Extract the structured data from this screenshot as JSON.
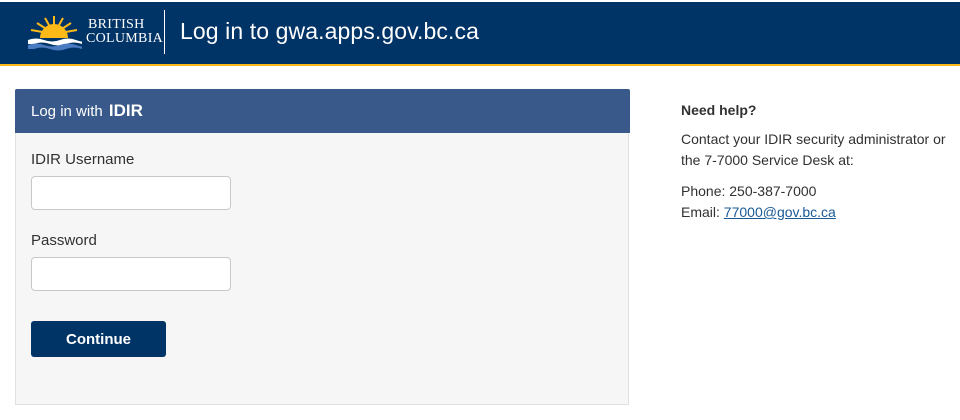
{
  "header": {
    "logo": {
      "line1": "BRITISH",
      "line2": "COLUMBIA",
      "icon": "bc-sun-logo-icon"
    },
    "title": "Log in to gwa.apps.gov.bc.ca"
  },
  "login": {
    "heading_prefix": "Log in with",
    "heading_brand": "IDIR",
    "username_label": "IDIR Username",
    "username_value": "",
    "password_label": "Password",
    "password_value": "",
    "continue_label": "Continue"
  },
  "help": {
    "title": "Need help?",
    "description": "Contact your IDIR security administrator or the 7-7000 Service Desk at:",
    "phone_label": "Phone:",
    "phone_value": "250-387-7000",
    "email_label": "Email:",
    "email_value": "77000@gov.bc.ca"
  },
  "colors": {
    "header_bg": "#003366",
    "header_accent": "#fcba19",
    "panel_header_bg": "#38598a",
    "button_bg": "#003366",
    "link": "#1a5a96"
  }
}
